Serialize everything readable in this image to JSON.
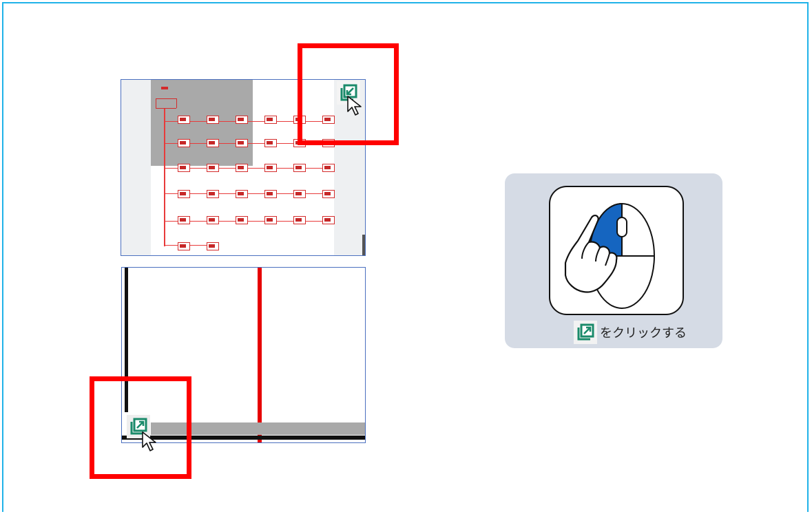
{
  "instruction": {
    "caption": "をクリックする",
    "mouse_icon": "mouse-left-click-icon",
    "button_icon": "expand-arrow-icon"
  },
  "panels": {
    "top": {
      "icon": "collapse-arrow-icon",
      "cursor": "pointer-cursor-icon"
    },
    "bottom": {
      "icon": "expand-arrow-icon",
      "cursor": "pointer-cursor-icon"
    }
  },
  "colors": {
    "accent_green": "#1a8a6a",
    "highlight_red": "#ff0000",
    "mouse_button_blue": "#1565c0",
    "frame_blue": "#1fb2e8",
    "card_bg": "#d5dbe5"
  }
}
